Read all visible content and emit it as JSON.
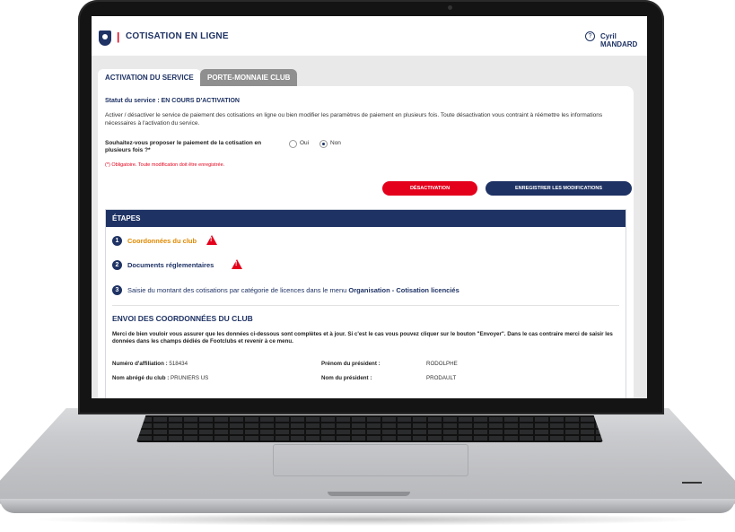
{
  "header": {
    "separator": "|",
    "title": "COTISATION EN LIGNE",
    "help_symbol": "?",
    "user": "Cyril MANDARD"
  },
  "tabs": [
    {
      "label": "ACTIVATION DU SERVICE",
      "active": true
    },
    {
      "label": "PORTE-MONNAIE CLUB",
      "active": false
    }
  ],
  "panel": {
    "status": "Statut du service : EN COURS D'ACTIVATION",
    "intro": "Activer / désactiver le service de paiement des cotisations en ligne ou bien modifier les paramètres de paiement en plusieurs fois. Toute désactivation vous contraint à réémettre les informations nécessaires à l'activation du service.",
    "question": "Souhaitez-vous proposer le paiement de la cotisation en plusieurs fois ?*",
    "option_yes": "Oui",
    "option_no": "Non",
    "selected": "Non",
    "required_note": "(*) Obligatoire. Toute modification doit être enregistrée.",
    "deactivate_label": "DÉSACTIVATION",
    "save_label": "ENREGISTRER LES MODIFICATIONS"
  },
  "steps": {
    "heading": "ÉTAPES",
    "items": [
      {
        "num": "1",
        "text": "Coordonnées du club",
        "warning": true,
        "color": "#e08a00"
      },
      {
        "num": "2",
        "text": "Documents réglementaires",
        "warning": true,
        "color": "#1e3264"
      },
      {
        "num": "3",
        "text_before": "Saisie du montant des cotisations par catégorie de licences dans le menu",
        "text_bold": "Organisation - Cotisation licenciés",
        "color": "#1e3264"
      }
    ]
  },
  "club": {
    "title": "ENVOI DES COORDONNÉES DU CLUB",
    "text": "Merci de bien vouloir vous assurer que les données ci-dessous sont complètes et à jour. Si c'est le cas vous pouvez cliquer sur le bouton \"Envoyer\". Dans le cas contraire merci de saisir les données dans les champs dédiés de Footclubs et revenir à ce menu.",
    "affiliation_label": "Numéro d'affiliation :",
    "affiliation_value": "518434",
    "short_name_label": "Nom abrégé du club :",
    "short_name_value": "PRUNIERS US",
    "president_first_label": "Prénom du président :",
    "president_first_value": "RODOLPHE",
    "president_last_label": "Nom du président :",
    "president_last_value": "PRODAULT"
  },
  "colors": {
    "navy": "#1e3264",
    "red": "#e4001b",
    "orange": "#e08a00"
  },
  "icons": [
    "club-logo-icon",
    "help-icon",
    "warning-icon"
  ]
}
